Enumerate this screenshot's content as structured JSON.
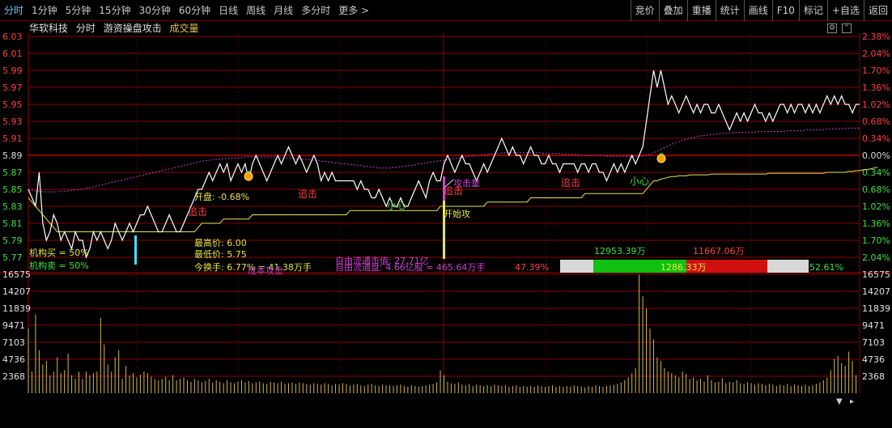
{
  "tabs": [
    "分时",
    "1分钟",
    "5分钟",
    "15分钟",
    "30分钟",
    "60分钟",
    "日线",
    "周线",
    "月线",
    "多分时",
    "更多 >"
  ],
  "active_tab": 0,
  "right_buttons": [
    "竞价",
    "叠加",
    "重播",
    "统计",
    "画线",
    "F10",
    "标记",
    "+自选",
    "返回"
  ],
  "title": {
    "stock_name": "华软科技",
    "mode": "分时",
    "indicator": "游资操盘攻击",
    "volume_label": "成交量"
  },
  "colors": {
    "grid": "#8a0000",
    "price_line": "#ffffff",
    "avg_line": "#e6e64d",
    "ma_line": "#c040c0",
    "up": "#ff4040",
    "down": "#40e040",
    "volume": "#d4b84a",
    "axis_red": "#ff4040",
    "axis_green": "#40e040"
  },
  "price_axis": {
    "left_labels": [
      "6.03",
      "6.01",
      "5.99",
      "5.97",
      "5.95",
      "5.93",
      "5.91",
      "5.89",
      "5.87",
      "5.85",
      "5.83",
      "5.81",
      "5.79",
      "5.77"
    ],
    "right_labels": [
      "2.38%",
      "2.04%",
      "1.70%",
      "1.36%",
      "1.02%",
      "0.68%",
      "0.34%",
      "0.00%",
      "0.34%",
      "0.68%",
      "1.02%",
      "1.36%",
      "1.70%",
      "2.04%"
    ],
    "up_count": 7
  },
  "volume_axis": {
    "labels": [
      "16575",
      "14207",
      "11839",
      "9471",
      "7103",
      "4736",
      "2368"
    ]
  },
  "chart_data": {
    "type": "line",
    "prev_close": 5.89,
    "ylim": [
      5.77,
      6.03
    ],
    "price": [
      5.85,
      5.84,
      5.83,
      5.87,
      5.81,
      5.79,
      5.8,
      5.82,
      5.81,
      5.79,
      5.8,
      5.79,
      5.78,
      5.8,
      5.79,
      5.79,
      5.77,
      5.78,
      5.8,
      5.79,
      5.8,
      5.79,
      5.78,
      5.79,
      5.81,
      5.8,
      5.79,
      5.8,
      5.81,
      5.8,
      5.81,
      5.82,
      5.82,
      5.83,
      5.82,
      5.81,
      5.8,
      5.8,
      5.81,
      5.82,
      5.81,
      5.8,
      5.8,
      5.81,
      5.82,
      5.83,
      5.84,
      5.85,
      5.85,
      5.86,
      5.87,
      5.86,
      5.87,
      5.88,
      5.87,
      5.88,
      5.86,
      5.87,
      5.88,
      5.87,
      5.88,
      5.86,
      5.88,
      5.89,
      5.88,
      5.87,
      5.86,
      5.87,
      5.88,
      5.89,
      5.88,
      5.89,
      5.9,
      5.89,
      5.88,
      5.89,
      5.88,
      5.87,
      5.88,
      5.89,
      5.88,
      5.86,
      5.87,
      5.86,
      5.87,
      5.86,
      5.86,
      5.86,
      5.86,
      5.86,
      5.86,
      5.85,
      5.86,
      5.85,
      5.85,
      5.84,
      5.84,
      5.85,
      5.84,
      5.83,
      5.84,
      5.83,
      5.83,
      5.84,
      5.83,
      5.83,
      5.84,
      5.85,
      5.86,
      5.85,
      5.84,
      5.86,
      5.87,
      5.86,
      5.86,
      5.88,
      5.89,
      5.88,
      5.87,
      5.88,
      5.89,
      5.88,
      5.88,
      5.87,
      5.86,
      5.87,
      5.88,
      5.87,
      5.88,
      5.89,
      5.9,
      5.91,
      5.9,
      5.89,
      5.9,
      5.89,
      5.89,
      5.88,
      5.89,
      5.9,
      5.89,
      5.89,
      5.88,
      5.88,
      5.89,
      5.88,
      5.88,
      5.87,
      5.88,
      5.88,
      5.88,
      5.88,
      5.87,
      5.88,
      5.88,
      5.87,
      5.88,
      5.88,
      5.87,
      5.87,
      5.86,
      5.87,
      5.88,
      5.87,
      5.88,
      5.87,
      5.88,
      5.89,
      5.88,
      5.89,
      5.9,
      5.93,
      5.96,
      5.99,
      5.97,
      5.99,
      5.97,
      5.95,
      5.96,
      5.95,
      5.94,
      5.95,
      5.96,
      5.95,
      5.94,
      5.95,
      5.94,
      5.95,
      5.95,
      5.94,
      5.94,
      5.95,
      5.94,
      5.93,
      5.92,
      5.93,
      5.94,
      5.93,
      5.94,
      5.93,
      5.94,
      5.95,
      5.94,
      5.94,
      5.93,
      5.94,
      5.93,
      5.94,
      5.95,
      5.95,
      5.94,
      5.95,
      5.94,
      5.95,
      5.95,
      5.94,
      5.95,
      5.94,
      5.95,
      5.94,
      5.95,
      5.96,
      5.95,
      5.96,
      5.95,
      5.96,
      5.95,
      5.95,
      5.94,
      5.95,
      5.95
    ],
    "avg": [
      5.84,
      5.835,
      5.83,
      5.825,
      5.82,
      5.815,
      5.81,
      5.805,
      5.8,
      5.8,
      5.8,
      5.8,
      5.8,
      5.8,
      5.8,
      5.8,
      5.8,
      5.8,
      5.8,
      5.8,
      5.8,
      5.8,
      5.8,
      5.8,
      5.8,
      5.8,
      5.8,
      5.8,
      5.8,
      5.8,
      5.8,
      5.8,
      5.8,
      5.8,
      5.8,
      5.8,
      5.8,
      5.8,
      5.8,
      5.8,
      5.8,
      5.8,
      5.8,
      5.8,
      5.8,
      5.8,
      5.8,
      5.805,
      5.81,
      5.81,
      5.81,
      5.81,
      5.81,
      5.81,
      5.815,
      5.815,
      5.815,
      5.815,
      5.815,
      5.815,
      5.815,
      5.815,
      5.82,
      5.82,
      5.82,
      5.82,
      5.82,
      5.82,
      5.82,
      5.82,
      5.82,
      5.82,
      5.82,
      5.82,
      5.82,
      5.82,
      5.82,
      5.82,
      5.82,
      5.82,
      5.82,
      5.82,
      5.82,
      5.82,
      5.82,
      5.82,
      5.82,
      5.82,
      5.82,
      5.825,
      5.825,
      5.825,
      5.825,
      5.825,
      5.825,
      5.825,
      5.825,
      5.825,
      5.825,
      5.825,
      5.825,
      5.825,
      5.825,
      5.825,
      5.825,
      5.825,
      5.825,
      5.825,
      5.825,
      5.825,
      5.825,
      5.825,
      5.825,
      5.825,
      5.83,
      5.83,
      5.83,
      5.83,
      5.83,
      5.83,
      5.83,
      5.83,
      5.83,
      5.83,
      5.83,
      5.83,
      5.83,
      5.835,
      5.835,
      5.835,
      5.835,
      5.835,
      5.835,
      5.835,
      5.835,
      5.835,
      5.835,
      5.835,
      5.835,
      5.84,
      5.84,
      5.84,
      5.84,
      5.84,
      5.84,
      5.84,
      5.84,
      5.84,
      5.84,
      5.84,
      5.84,
      5.84,
      5.84,
      5.84,
      5.845,
      5.845,
      5.845,
      5.845,
      5.845,
      5.845,
      5.845,
      5.845,
      5.845,
      5.845,
      5.845,
      5.845,
      5.845,
      5.845,
      5.845,
      5.845,
      5.845,
      5.85,
      5.855,
      5.86,
      5.86,
      5.862,
      5.863,
      5.864,
      5.865,
      5.865,
      5.866,
      5.866,
      5.866,
      5.867,
      5.867,
      5.867,
      5.867,
      5.867,
      5.867,
      5.868,
      5.868,
      5.868,
      5.868,
      5.868,
      5.868,
      5.868,
      5.868,
      5.868,
      5.868,
      5.868,
      5.868,
      5.868,
      5.868,
      5.868,
      5.868,
      5.869,
      5.869,
      5.869,
      5.869,
      5.869,
      5.869,
      5.869,
      5.869,
      5.869,
      5.869,
      5.869,
      5.869,
      5.869,
      5.869,
      5.869,
      5.869,
      5.87,
      5.87,
      5.87,
      5.87,
      5.87,
      5.87,
      5.871,
      5.871,
      5.872,
      5.872,
      5.873,
      5.873,
      5.874,
      5.875,
      5.876
    ],
    "ma": [
      5.85,
      5.849,
      5.848,
      5.848,
      5.847,
      5.847,
      5.847,
      5.847,
      5.847,
      5.848,
      5.848,
      5.848,
      5.849,
      5.849,
      5.85,
      5.85,
      5.851,
      5.852,
      5.853,
      5.854,
      5.855,
      5.856,
      5.857,
      5.858,
      5.859,
      5.86,
      5.861,
      5.862,
      5.863,
      5.864,
      5.865,
      5.866,
      5.867,
      5.868,
      5.869,
      5.87,
      5.871,
      5.872,
      5.873,
      5.874,
      5.875,
      5.876,
      5.877,
      5.878,
      5.879,
      5.88,
      5.881,
      5.882,
      5.883,
      5.884,
      5.884,
      5.885,
      5.885,
      5.886,
      5.886,
      5.886,
      5.887,
      5.887,
      5.887,
      5.887,
      5.888,
      5.888,
      5.888,
      5.888,
      5.888,
      5.888,
      5.888,
      5.888,
      5.888,
      5.888,
      5.887,
      5.887,
      5.887,
      5.887,
      5.886,
      5.886,
      5.885,
      5.885,
      5.885,
      5.884,
      5.884,
      5.883,
      5.883,
      5.882,
      5.882,
      5.881,
      5.881,
      5.88,
      5.88,
      5.879,
      5.879,
      5.878,
      5.878,
      5.877,
      5.877,
      5.876,
      5.876,
      5.875,
      5.875,
      5.875,
      5.875,
      5.876,
      5.876,
      5.877,
      5.877,
      5.878,
      5.878,
      5.879,
      5.88,
      5.88,
      5.881,
      5.882,
      5.882,
      5.883,
      5.884,
      5.884,
      5.885,
      5.886,
      5.886,
      5.887,
      5.888,
      5.888,
      5.889,
      5.889,
      5.89,
      5.89,
      5.891,
      5.891,
      5.892,
      5.892,
      5.892,
      5.893,
      5.893,
      5.893,
      5.893,
      5.893,
      5.893,
      5.893,
      5.893,
      5.893,
      5.893,
      5.893,
      5.893,
      5.892,
      5.892,
      5.892,
      5.892,
      5.892,
      5.891,
      5.891,
      5.891,
      5.891,
      5.891,
      5.89,
      5.89,
      5.89,
      5.89,
      5.89,
      5.89,
      5.89,
      5.889,
      5.889,
      5.889,
      5.889,
      5.889,
      5.889,
      5.889,
      5.889,
      5.889,
      5.889,
      5.889,
      5.89,
      5.891,
      5.893,
      5.895,
      5.897,
      5.899,
      5.901,
      5.903,
      5.905,
      5.906,
      5.908,
      5.909,
      5.91,
      5.911,
      5.912,
      5.913,
      5.913,
      5.914,
      5.914,
      5.915,
      5.915,
      5.916,
      5.916,
      5.916,
      5.917,
      5.917,
      5.917,
      5.917,
      5.917,
      5.917,
      5.917,
      5.918,
      5.918,
      5.918,
      5.918,
      5.918,
      5.918,
      5.918,
      5.918,
      5.919,
      5.919,
      5.919,
      5.919,
      5.919,
      5.92,
      5.92,
      5.92,
      5.92,
      5.92,
      5.92,
      5.921,
      5.921,
      5.921,
      5.921,
      5.921,
      5.922,
      5.922,
      5.922,
      5.922,
      5.922
    ],
    "volume": [
      9000,
      3000,
      11000,
      6000,
      4000,
      4500,
      2500,
      3000,
      5000,
      2800,
      3200,
      5500,
      2500,
      2000,
      3000,
      2000,
      3000,
      2500,
      2800,
      3000,
      10500,
      6800,
      4000,
      3000,
      5000,
      6000,
      2000,
      3800,
      2500,
      2800,
      2200,
      2600,
      3000,
      2800,
      2300,
      2000,
      1800,
      2000,
      2300,
      1800,
      2500,
      1800,
      2000,
      2200,
      1800,
      1600,
      2000,
      1800,
      1500,
      1700,
      2000,
      1500,
      1800,
      1600,
      1400,
      1800,
      1500,
      1400,
      1600,
      1800,
      1500,
      1700,
      1400,
      1500,
      1600,
      1400,
      1300,
      1600,
      1500,
      1400,
      1600,
      1300,
      1400,
      1500,
      1300,
      1500,
      1400,
      1300,
      1200,
      1400,
      1300,
      1200,
      1400,
      1300,
      1100,
      1300,
      1200,
      1400,
      1300,
      1100,
      1200,
      1300,
      1100,
      1000,
      1200,
      1300,
      1100,
      1000,
      1200,
      1100,
      1100,
      1000,
      1100,
      1200,
      1000,
      900,
      1100,
      1000,
      900,
      1000,
      1100,
      1200,
      1300,
      1500,
      3200,
      2500,
      1600,
      1400,
      1300,
      1500,
      1200,
      1100,
      1300,
      1000,
      1200,
      1100,
      1000,
      1100,
      1000,
      1200,
      1100,
      1000,
      1100,
      900,
      1000,
      1100,
      900,
      1000,
      900,
      1000,
      900,
      1100,
      1000,
      900,
      1000,
      1100,
      900,
      1000,
      900,
      1000,
      900,
      1100,
      1000,
      900,
      800,
      1000,
      900,
      1100,
      1000,
      900,
      1000,
      1100,
      1200,
      1300,
      1500,
      1800,
      2200,
      2800,
      3500,
      16500,
      13500,
      11800,
      9000,
      7500,
      5000,
      4500,
      3500,
      3000,
      2800,
      2500,
      2200,
      3000,
      2700,
      2000,
      2200,
      1800,
      2000,
      1600,
      2500,
      1800,
      1500,
      1600,
      2100,
      1400,
      1600,
      1500,
      1800,
      1400,
      1300,
      1500,
      1400,
      1200,
      1400,
      1300,
      1100,
      1300,
      1200,
      1000,
      1200,
      1100,
      1300,
      1000,
      1200,
      1100,
      1000,
      1200,
      1000,
      1100,
      1300,
      1500,
      1800,
      2200,
      3200,
      4800,
      5200,
      4200,
      3800,
      5800,
      4500,
      2500
    ]
  },
  "annotations": {
    "zhuiji": "追击",
    "xiaoxin": "小心",
    "open_change": "开盘: -0.68%",
    "high_price": "最高价: 6.00",
    "low_price": "最低价: 5.75",
    "turnover": "今换手: 6.77% = 41.38万手",
    "float_value": "自由流通市值: 27.71亿",
    "float_shares": "自由流通盘: 4.66亿股 = 465.64万手",
    "inst_buy": "机构买 = 50%",
    "inst_sell": "机构卖 = 50%",
    "attack_label": "攻击量",
    "start_attack": "开始攻",
    "cost_label": "成本攻击",
    "buy_amount": "12953.39万",
    "sell_amount": "11667.06万",
    "mid_amount": "1286.33万",
    "buy_pct": "47.39%",
    "sell_pct": "52.61%"
  }
}
